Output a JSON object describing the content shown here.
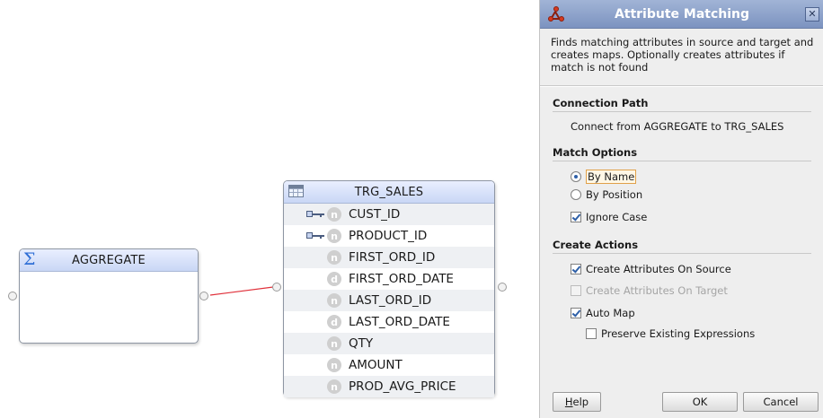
{
  "canvas": {
    "aggregate": {
      "title": "AGGREGATE",
      "icon": "sigma-icon"
    },
    "target": {
      "title": "TRG_SALES",
      "icon": "table-icon",
      "attributes": [
        {
          "name": "CUST_ID",
          "key": true,
          "type_glyph": "n"
        },
        {
          "name": "PRODUCT_ID",
          "key": true,
          "type_glyph": "n"
        },
        {
          "name": "FIRST_ORD_ID",
          "key": false,
          "type_glyph": "n"
        },
        {
          "name": "FIRST_ORD_DATE",
          "key": false,
          "type_glyph": "d"
        },
        {
          "name": "LAST_ORD_ID",
          "key": false,
          "type_glyph": "n"
        },
        {
          "name": "LAST_ORD_DATE",
          "key": false,
          "type_glyph": "d"
        },
        {
          "name": "QTY",
          "key": false,
          "type_glyph": "n"
        },
        {
          "name": "AMOUNT",
          "key": false,
          "type_glyph": "n"
        },
        {
          "name": "PROD_AVG_PRICE",
          "key": false,
          "type_glyph": "n"
        }
      ]
    },
    "connector_color": "#e0303a"
  },
  "dialog": {
    "title": "Attribute Matching",
    "close_glyph": "✕",
    "description": "Finds matching attributes in source and target and creates maps.  Optionally creates attributes if match is not found",
    "connection_path": {
      "heading": "Connection Path",
      "text": "Connect from AGGREGATE to TRG_SALES"
    },
    "match_options": {
      "heading": "Match Options",
      "by_name": "By Name",
      "by_position": "By Position",
      "ignore_case": "Ignore Case",
      "selected": "By Name",
      "ignore_case_checked": true
    },
    "create_actions": {
      "heading": "Create Actions",
      "on_source": "Create Attributes On Source",
      "on_target": "Create Attributes On Target",
      "auto_map": "Auto Map",
      "preserve": "Preserve Existing Expressions",
      "on_source_checked": true,
      "on_target_checked": false,
      "on_target_disabled": true,
      "auto_map_checked": true,
      "preserve_checked": false
    },
    "buttons": {
      "help_prefix": "",
      "help_mnemonic": "H",
      "help_rest": "elp",
      "ok": "OK",
      "cancel": "Cancel"
    }
  }
}
